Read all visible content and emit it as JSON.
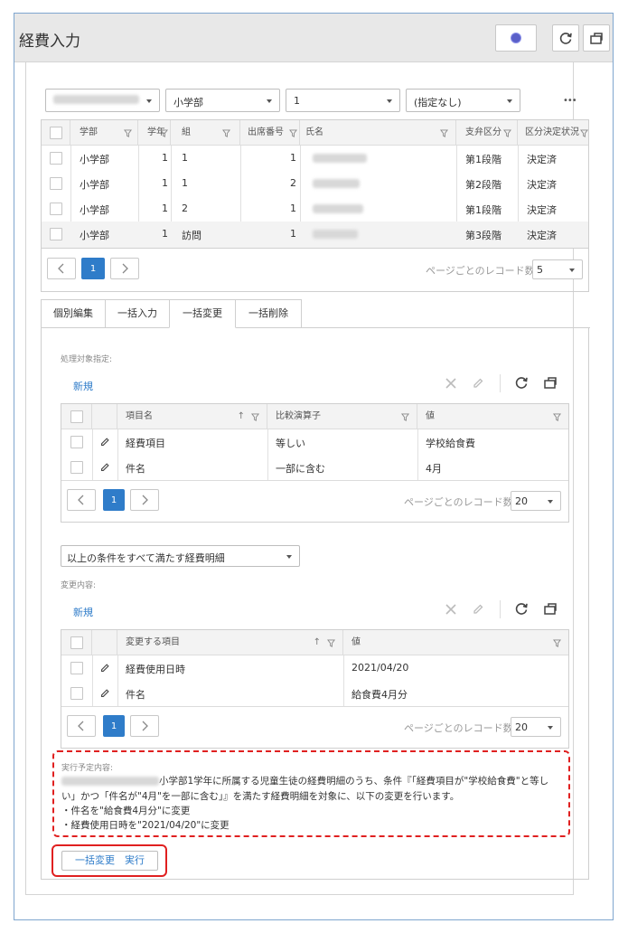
{
  "page": {
    "title": "経費入力"
  },
  "filters": {
    "f1": "",
    "f2": "小学部",
    "f3": "1",
    "f4": "(指定なし)",
    "more": "•••"
  },
  "students": {
    "columns": [
      "学部",
      "学年",
      "組",
      "出席番号",
      "氏名",
      "支弁区分",
      "区分決定状況"
    ],
    "rows": [
      {
        "dept": "小学部",
        "grade": "1",
        "cls": "1",
        "no": "1",
        "stage": "第1段階",
        "status": "決定済"
      },
      {
        "dept": "小学部",
        "grade": "1",
        "cls": "1",
        "no": "2",
        "stage": "第2段階",
        "status": "決定済"
      },
      {
        "dept": "小学部",
        "grade": "1",
        "cls": "2",
        "no": "1",
        "stage": "第1段階",
        "status": "決定済"
      },
      {
        "dept": "小学部",
        "grade": "1",
        "cls": "訪問",
        "no": "1",
        "stage": "第3段階",
        "status": "決定済"
      }
    ],
    "page": "1",
    "page_size_label": "ページごとのレコード数",
    "page_size": "5"
  },
  "tabs": [
    "個別編集",
    "一括入力",
    "一括変更",
    "一括削除"
  ],
  "target": {
    "section_label": "処理対象指定:",
    "new_label": "新規",
    "columns": [
      "項目名",
      "比較演算子",
      "値"
    ],
    "rows": [
      {
        "name": "経費項目",
        "op": "等しい",
        "value": "学校給食費"
      },
      {
        "name": "件名",
        "op": "一部に含む",
        "value": "4月"
      }
    ],
    "page": "1",
    "page_size_label": "ページごとのレコード数",
    "page_size": "20"
  },
  "condition_select": "以上の条件をすべて満たす経費明細",
  "change": {
    "section_label": "変更内容:",
    "new_label": "新規",
    "columns": [
      "変更する項目",
      "値"
    ],
    "rows": [
      {
        "name": "経費使用日時",
        "value": "2021/04/20"
      },
      {
        "name": "件名",
        "value": "給食費4月分"
      }
    ],
    "page": "1",
    "page_size_label": "ページごとのレコード数",
    "page_size": "20"
  },
  "plan": {
    "label": "実行予定内容:",
    "line1": "小学部1学年に所属する児童生徒の経費明細のうち、条件『「経費項目が\"学校給食費\"と等し",
    "line2": "い」かつ「件名が\"4月\"を一部に含む」』を満たす経費明細を対象に、以下の変更を行います。",
    "line3": "・件名を\"給食費4月分\"に変更",
    "line4": "・経費使用日時を\"2021/04/20\"に変更"
  },
  "exec_button": "一括変更　実行",
  "colors": {
    "accent": "#2f7cc9",
    "highlight": "#e02020"
  }
}
